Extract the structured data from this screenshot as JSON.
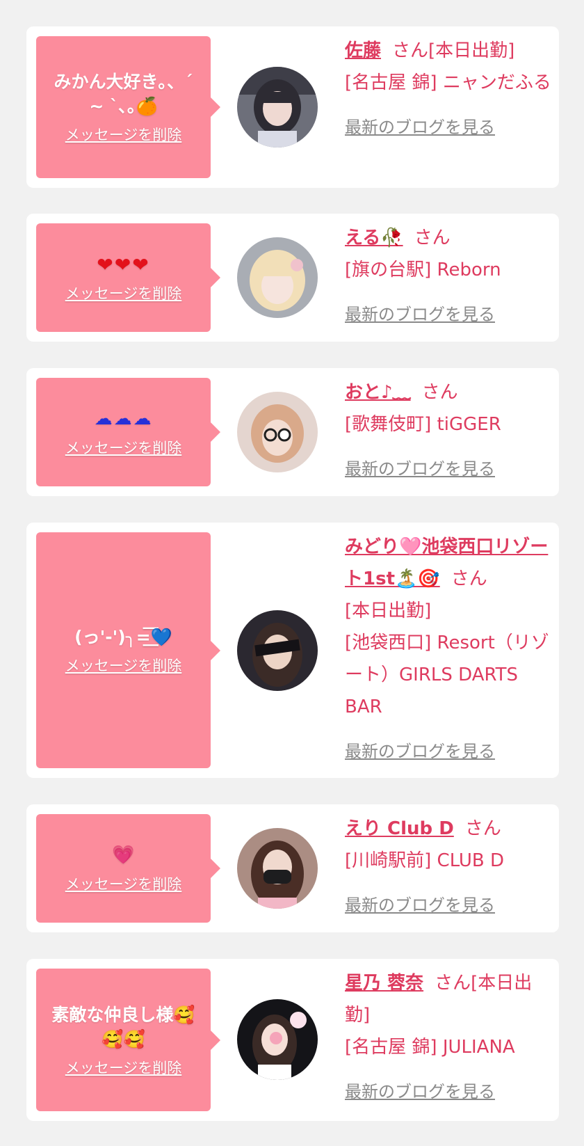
{
  "entries": [
    {
      "message": "みかん大好き｡、´ ~ `､｡🍊",
      "delete_label": "メッセージを削除",
      "name": "佐藤",
      "suffix": "さん",
      "tag": "[本日出勤]",
      "shop": "[名古屋 錦] ニャンだふる",
      "blog_label": "最新のブログを見る"
    },
    {
      "message": "❤❤❤",
      "delete_label": "メッセージを削除",
      "name": "える🥀",
      "suffix": "さん",
      "tag": "",
      "shop": "[旗の台駅] Reborn",
      "blog_label": "最新のブログを見る"
    },
    {
      "message": "☁☁☁",
      "delete_label": "メッセージを削除",
      "name": "おと♪﹏",
      "suffix": "さん",
      "tag": "",
      "shop": "[歌舞伎町] tiGGER",
      "blog_label": "最新のブログを見る"
    },
    {
      "message": "(っ'-')╮=͟͟͞͞💙",
      "delete_label": "メッセージを削除",
      "name": "みどり🩷池袋西口リゾート1st🏝️🎯",
      "suffix": "さん",
      "tag": "[本日出勤]",
      "shop": "[池袋西口] Resort（リゾート）GIRLS DARTS BAR",
      "blog_label": "最新のブログを見る"
    },
    {
      "message": "💗",
      "delete_label": "メッセージを削除",
      "name": "えり Club D",
      "suffix": "さん",
      "tag": "",
      "shop": "[川崎駅前] CLUB D",
      "blog_label": "最新のブログを見る"
    },
    {
      "message": "素敵な仲良し様🥰🥰🥰",
      "delete_label": "メッセージを削除",
      "name": "星乃 蓉奈",
      "suffix": "さん",
      "tag": "[本日出勤]",
      "shop": "[名古屋 錦] JULIANA",
      "blog_label": "最新のブログを見る"
    }
  ],
  "colors": {
    "background": "#f1f1f1",
    "bubble": "#fc8c9c",
    "name": "#de3b5f",
    "blog_link": "#8a8a8a"
  }
}
